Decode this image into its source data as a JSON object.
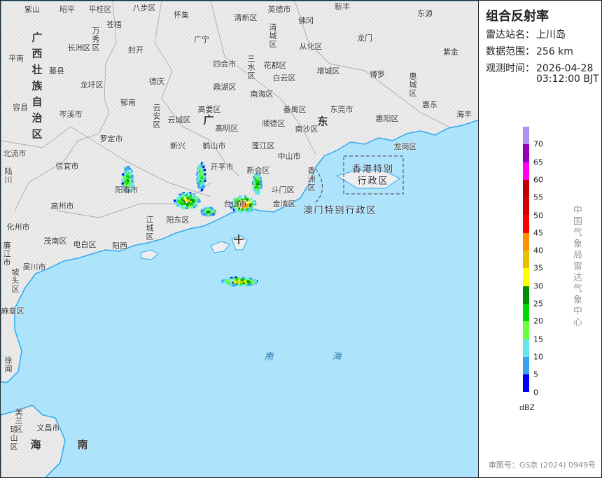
{
  "panel": {
    "title": "组合反射率",
    "station_label": "雷达站名：",
    "station": "上川岛",
    "range_label": "数据范围：",
    "range": "256 km",
    "time_label": "观测时间：",
    "date": "2026-04-28",
    "time": "03:12:00 BJT",
    "unit": "dBZ",
    "credit": "中国气象局雷达气象中心",
    "approval": "审图号：GS京 (2024) 0949号"
  },
  "legend": {
    "ticks": [
      "70",
      "65",
      "60",
      "55",
      "50",
      "45",
      "40",
      "35",
      "30",
      "25",
      "20",
      "15",
      "10",
      "5",
      "0"
    ],
    "colors": [
      "#ad90f0",
      "#9600b4",
      "#ff00f0",
      "#c00000",
      "#d60000",
      "#ff0000",
      "#ff9000",
      "#e7c000",
      "#ffff00",
      "#008f00",
      "#00d800",
      "#6cff3c",
      "#60e8ec",
      "#3c9ff0",
      "#0000f6"
    ]
  },
  "map": {
    "province_labels": [
      "广西壮族自治区",
      "广",
      "东",
      "海",
      "南"
    ],
    "sea_labels": [
      "南",
      "海"
    ],
    "sar_labels": [
      "香港特别",
      "行政区",
      "澳门特别行政区"
    ],
    "places": [
      "紫山",
      "昭平",
      "平桂区",
      "八步区",
      "怀集",
      "清新区",
      "英德市",
      "新丰",
      "东源",
      "佛冈",
      "苍梧",
      "万秀区",
      "长洲区",
      "封开",
      "广宁",
      "清城区",
      "从化区",
      "龙门",
      "紫金",
      "平南",
      "藤县",
      "四会市",
      "三水区",
      "花都区",
      "白云区",
      "增城区",
      "博罗",
      "惠城区",
      "龙圩区",
      "德庆",
      "鼎湖区",
      "南海区",
      "容县",
      "郁南",
      "云安区",
      "高要区",
      "番禺区",
      "东莞市",
      "惠东",
      "海丰",
      "岑溪市",
      "云城区",
      "高明区",
      "顺德区",
      "南沙区",
      "惠阳区",
      "罗定市",
      "新兴",
      "鹤山市",
      "蓬江区",
      "龙岗区",
      "中山市",
      "北流市",
      "信宜市",
      "开平市",
      "新会区",
      "阳春市",
      "香洲区",
      "斗门区",
      "陆川",
      "高州市",
      "台山市",
      "金湾区",
      "阳东区",
      "化州市",
      "江城区",
      "茂南区",
      "电白区",
      "阳西",
      "吴川市",
      "廉江市",
      "坡头区",
      "麻章区",
      "徐闻",
      "美兰区",
      "文昌市",
      "琼山区"
    ],
    "land_color": "#eeeeee",
    "sea_color": "#aee4fb",
    "coast_color": "#2fa8f0",
    "station_marker": "plus-icon"
  }
}
